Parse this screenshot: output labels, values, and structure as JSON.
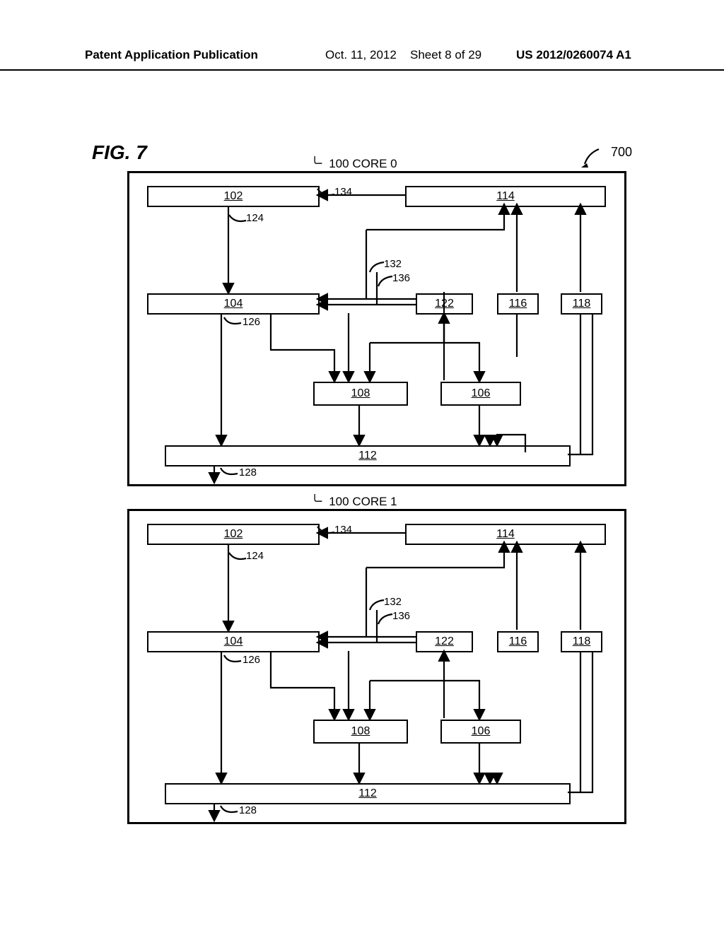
{
  "header": {
    "left": "Patent Application Publication",
    "date": "Oct. 11, 2012",
    "sheet": "Sheet 8 of 29",
    "pub": "US 2012/0260074 A1"
  },
  "figure": {
    "label": "FIG. 7",
    "overall_ref": "700"
  },
  "cores": [
    {
      "label_prefix": "100",
      "label": "CORE 0"
    },
    {
      "label_prefix": "100",
      "label": "CORE 1"
    }
  ],
  "blocks": {
    "b102": "102",
    "b104": "104",
    "b106": "106",
    "b108": "108",
    "b112": "112",
    "b114": "114",
    "b116": "116",
    "b118": "118",
    "b122": "122"
  },
  "refs": {
    "r124": "124",
    "r126": "126",
    "r128": "128",
    "r132": "132",
    "r134": "134",
    "r136": "136"
  }
}
